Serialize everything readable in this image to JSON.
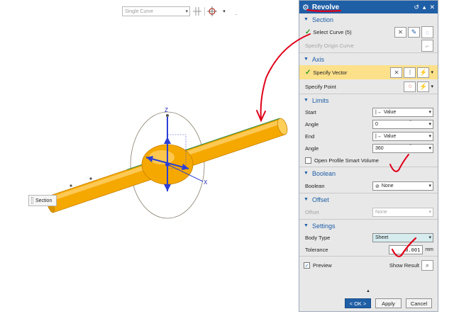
{
  "toolbar": {
    "curve_rule": "Single Curve",
    "icons": [
      "snap-grid-icon",
      "crosshair-icon",
      "menu-caret-icon"
    ]
  },
  "viewport": {
    "section_tip": "Section",
    "axis_labels": {
      "z": "Z",
      "x": "X"
    },
    "model_color": "#f5a800"
  },
  "dialog": {
    "title": "Revolve",
    "title_color": "#1f5fa6",
    "section": {
      "header": "Section",
      "select_curve": "Select Curve (5)",
      "specify_origin": "Specify Origin Curve"
    },
    "axis": {
      "header": "Axis",
      "specify_vector": "Specify Vector",
      "specify_point": "Specify Point"
    },
    "limits": {
      "header": "Limits",
      "start_label": "Start",
      "start_value": "Value",
      "angle_label": "Angle",
      "start_angle": "0",
      "angle_unit": "°",
      "end_label": "End",
      "end_value": "Value",
      "end_angle": "360",
      "open_profile": "Open Profile Smart Volume"
    },
    "boolean": {
      "header": "Boolean",
      "label": "Boolean",
      "value": "None"
    },
    "offset": {
      "header": "Offset",
      "label": "Offset",
      "value": "None"
    },
    "settings": {
      "header": "Settings",
      "body_type_label": "Body Type",
      "body_type_value": "Sheet",
      "tolerance_label": "Tolerance",
      "tolerance_value": "0.001",
      "tolerance_unit": "mm"
    },
    "preview": "Preview",
    "show_result": "Show Result",
    "ok": "< OK >",
    "apply": "Apply",
    "cancel": "Cancel"
  },
  "annotation_color": "#e0001a"
}
